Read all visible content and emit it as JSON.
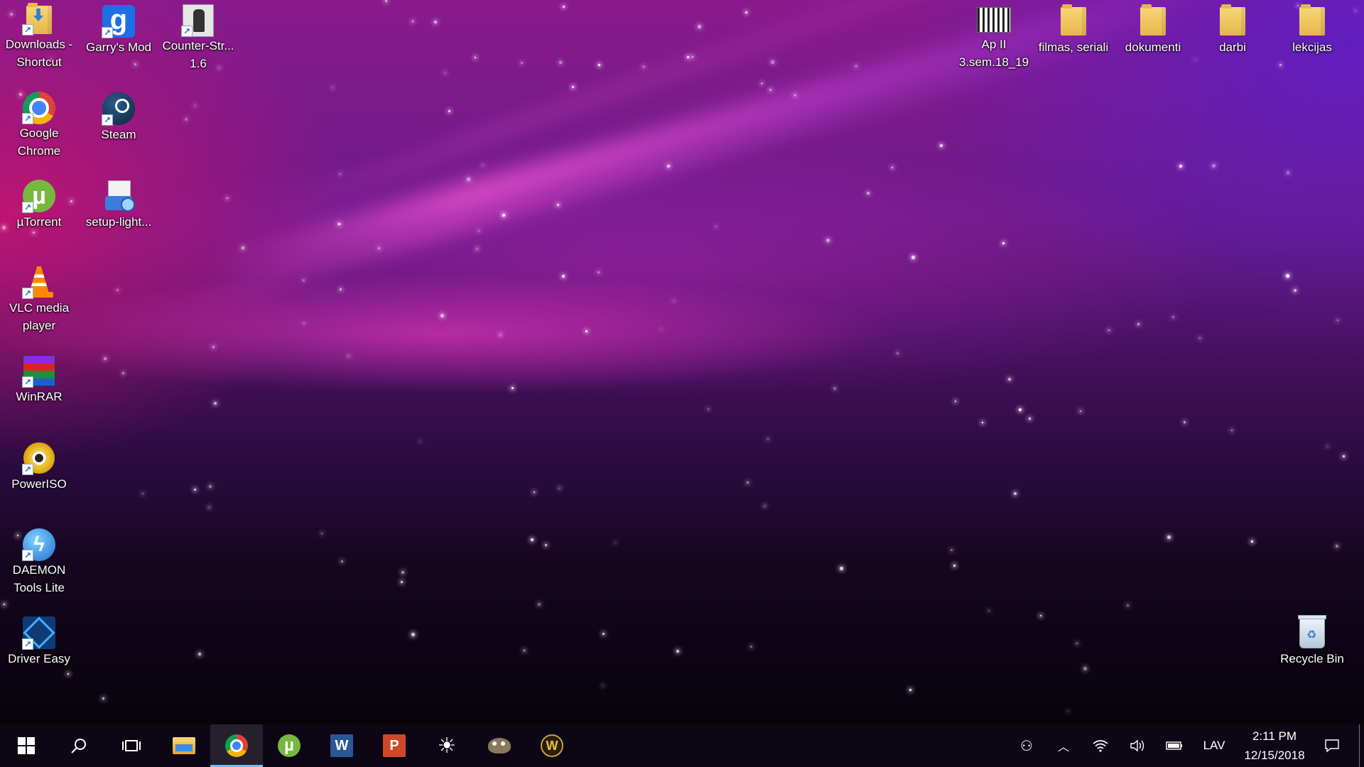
{
  "desktop": {
    "icons_left": [
      {
        "name": "downloads-shortcut",
        "label": "Downloads - Shortcut"
      },
      {
        "name": "garrys-mod",
        "label": "Garry's Mod"
      },
      {
        "name": "counter-strike",
        "label": "Counter-Str... 1.6"
      },
      {
        "name": "google-chrome",
        "label": "Google Chrome"
      },
      {
        "name": "steam",
        "label": "Steam"
      },
      {
        "name": "utorrent",
        "label": "µTorrent"
      },
      {
        "name": "setup-light",
        "label": "setup-light..."
      },
      {
        "name": "vlc",
        "label": "VLC media player"
      },
      {
        "name": "winrar",
        "label": "WinRAR"
      },
      {
        "name": "poweriso",
        "label": "PowerISO"
      },
      {
        "name": "daemon-tools",
        "label": "DAEMON Tools Lite"
      },
      {
        "name": "driver-easy",
        "label": "Driver Easy"
      }
    ],
    "icons_right": [
      {
        "name": "ap-ii",
        "label": "Ap II 3.sem.18_19"
      },
      {
        "name": "filmas-seriali",
        "label": "filmas, seriali"
      },
      {
        "name": "dokumenti",
        "label": "dokumenti"
      },
      {
        "name": "darbi",
        "label": "darbi"
      },
      {
        "name": "lekcijas",
        "label": "lekcijas"
      }
    ],
    "recycle_bin": {
      "label": "Recycle Bin"
    }
  },
  "taskbar": {
    "pinned": [
      {
        "name": "start",
        "icon": "windows-logo-icon"
      },
      {
        "name": "search",
        "icon": "search-icon"
      },
      {
        "name": "task-view",
        "icon": "task-view-icon"
      },
      {
        "name": "file-explorer",
        "icon": "folder-icon"
      },
      {
        "name": "chrome",
        "icon": "chrome-icon",
        "active": true
      },
      {
        "name": "utorrent",
        "icon": "utorrent-icon"
      },
      {
        "name": "word",
        "icon": "word-icon"
      },
      {
        "name": "powerpoint",
        "icon": "powerpoint-icon"
      },
      {
        "name": "brightness",
        "icon": "sun-icon"
      },
      {
        "name": "gimp",
        "icon": "gimp-icon"
      },
      {
        "name": "warcraft",
        "icon": "warcraft-icon"
      }
    ],
    "tray": {
      "language": "LAV",
      "time": "2:11 PM",
      "date": "12/15/2018"
    }
  },
  "colors": {
    "accent": "#76b9ed"
  }
}
